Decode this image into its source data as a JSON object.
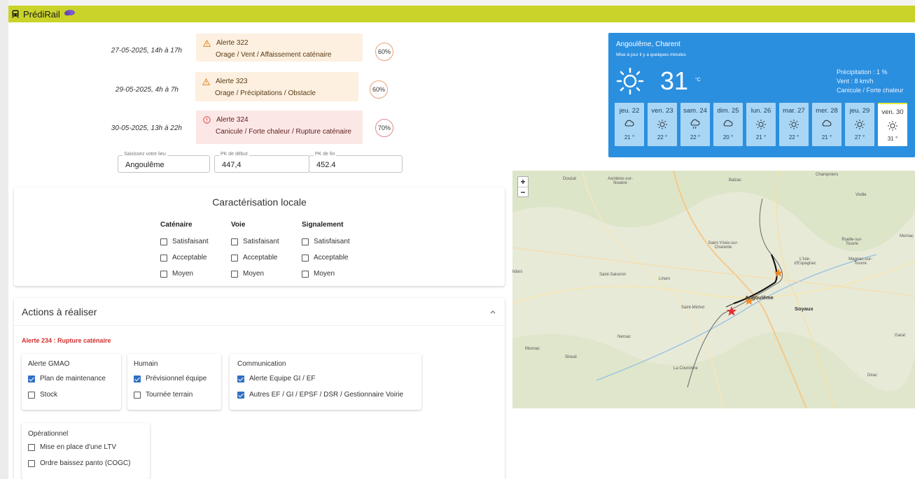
{
  "app": {
    "title": "PrédiRail"
  },
  "alerts": [
    {
      "date": "27-05-2025, 14h à 17h",
      "title": "Alerte 322",
      "desc": "Orage / Vent / Affaissement caténaire",
      "pct": "60%",
      "level": "warning"
    },
    {
      "date": "29-05-2025, 4h à 7h",
      "title": "Alerte 323",
      "desc": "Orage / Précipitations / Obstacle",
      "pct": "60%",
      "level": "warning"
    },
    {
      "date": "30-05-2025, 13h à 22h",
      "title": "Alerte 324",
      "desc": "Canicule / Forte chaleur / Rupture caténaire",
      "pct": "70%",
      "level": "error"
    }
  ],
  "fields": {
    "lieu": {
      "label": "Saisissez votre lieu",
      "value": "Angoulême"
    },
    "pk_debut": {
      "label": "PK de début",
      "value": "447,4"
    },
    "pk_fin": {
      "label": "PK de fin",
      "value": "452.4"
    }
  },
  "caracterisation": {
    "title": "Caractérisation locale",
    "columns": [
      {
        "head": "Caténaire",
        "options": [
          "Satisfaisant",
          "Acceptable",
          "Moyen"
        ]
      },
      {
        "head": "Voie",
        "options": [
          "Satisfaisant",
          "Acceptable",
          "Moyen"
        ]
      },
      {
        "head": "Signalement",
        "options": [
          "Satisfaisant",
          "Acceptable",
          "Moyen"
        ]
      }
    ]
  },
  "actions": {
    "title": "Actions à réaliser",
    "alert_label": "Alerte 234 : Rupture caténaire",
    "groups": [
      {
        "head": "Alerte GMAO",
        "items": [
          {
            "label": "Plan de maintenance",
            "checked": true
          },
          {
            "label": "Stock",
            "checked": false
          }
        ]
      },
      {
        "head": "Humain",
        "items": [
          {
            "label": "Prévisionnel équipe",
            "checked": true
          },
          {
            "label": "Tournée terrain",
            "checked": false
          }
        ]
      },
      {
        "head": "Communication",
        "items": [
          {
            "label": "Alerte Equipe GI / EF",
            "checked": true
          },
          {
            "label": "Autres EF / GI / EPSF / DSR / Gestionnaire Voirie",
            "checked": true
          }
        ]
      },
      {
        "head": "Opérationnel",
        "items": [
          {
            "label": "Mise en place d'une LTV",
            "checked": false
          },
          {
            "label": "Ordre baissez panto (COGC)",
            "checked": false
          }
        ]
      }
    ]
  },
  "weather": {
    "location": "Angoulême, Charent",
    "updated": "Mise à jour il y a quelques minutes",
    "temp": "31",
    "unit": "°C",
    "precip": "Précipitation : 1 %",
    "wind": "Vent : 8 km/h",
    "condition": "Canicule / Forte chaleur",
    "days": [
      {
        "name": "jeu. 22",
        "temp": "21 °",
        "icon": "cloud-icon"
      },
      {
        "name": "ven. 23",
        "temp": "22 °",
        "icon": "sun-icon"
      },
      {
        "name": "sam. 24",
        "temp": "22 °",
        "icon": "rain-icon"
      },
      {
        "name": "dim. 25",
        "temp": "20 °",
        "icon": "cloud-icon"
      },
      {
        "name": "lun. 26",
        "temp": "21 °",
        "icon": "sun-icon"
      },
      {
        "name": "mar. 27",
        "temp": "22 °",
        "icon": "sun-icon"
      },
      {
        "name": "mer. 28",
        "temp": "21 °",
        "icon": "cloud-icon"
      },
      {
        "name": "jeu. 29",
        "temp": "27 °",
        "icon": "sun-icon"
      },
      {
        "name": "ven. 30",
        "temp": "31 °",
        "icon": "sun-icon"
      }
    ]
  },
  "map": {
    "zoom_in": "+",
    "zoom_out": "−",
    "places": [
      "Douzat",
      "Asnières-sur-Nouère",
      "Balzac",
      "Champniers",
      "Viville",
      "Ruelle-sur-Touvre",
      "Magnac-sur-Touvre",
      "Mornac",
      "Saint-Yrieix-sur-Charente",
      "L'Isle-d'Espagnac",
      "Saint-Saturnin",
      "Linars",
      "Angoulême",
      "Soyaux",
      "Saint-Michel",
      "Nersac",
      "Sireuil",
      "Mosnac",
      "La Couronne",
      "Garat",
      "Dirac",
      "lidars"
    ]
  }
}
